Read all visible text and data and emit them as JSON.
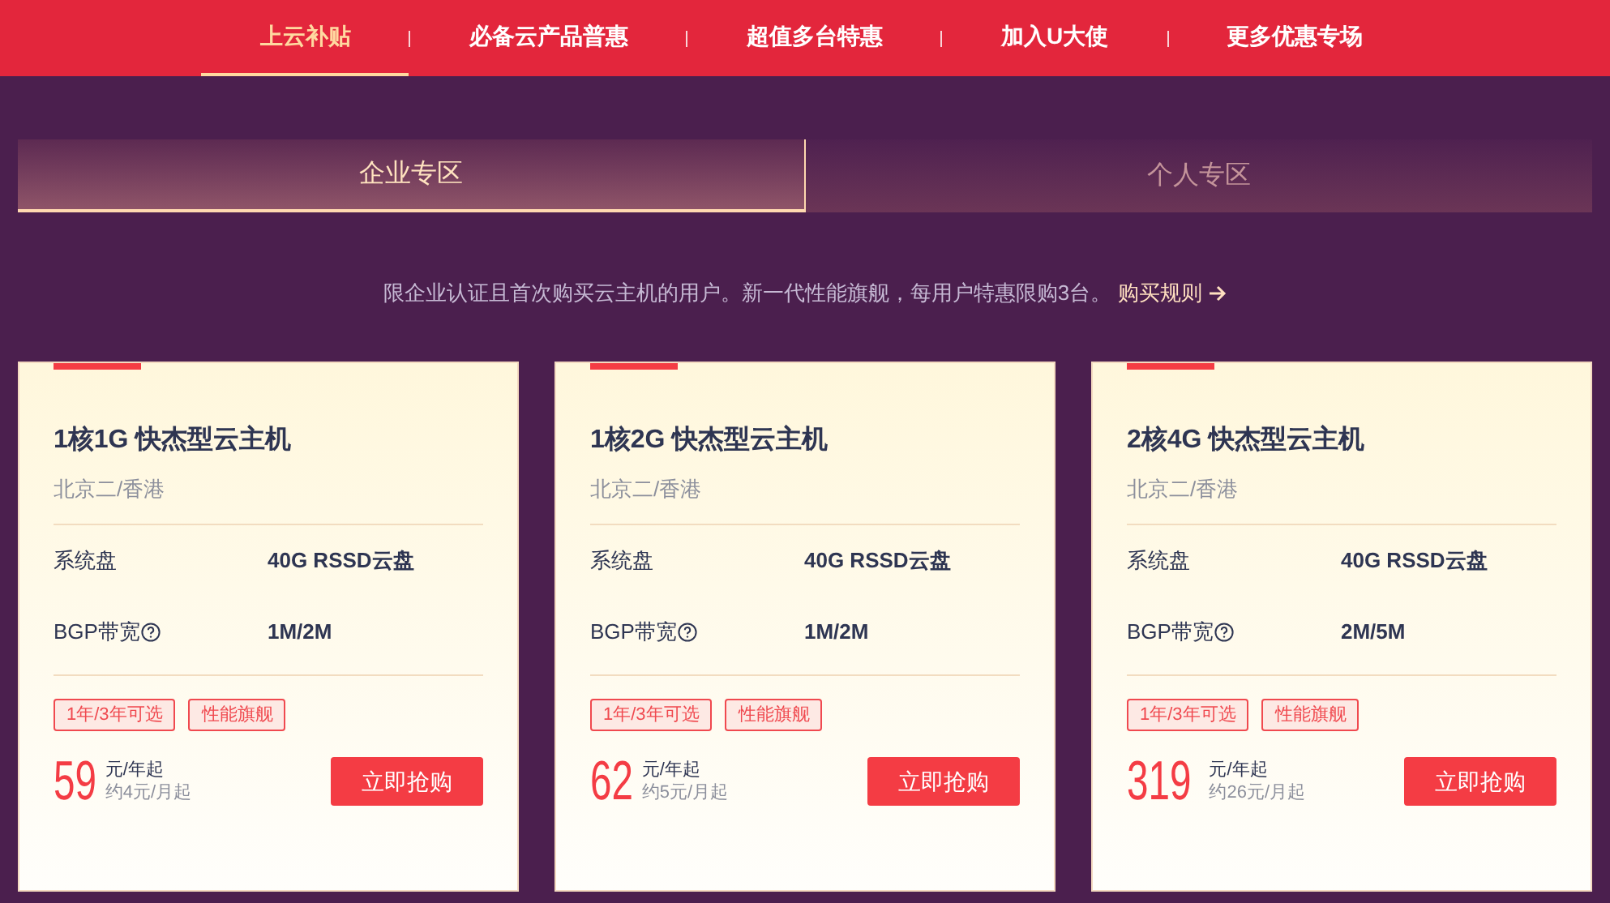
{
  "nav": [
    {
      "label": "上云补贴",
      "selected": true
    },
    {
      "label": "必备云产品普惠",
      "selected": false
    },
    {
      "label": "超值多台特惠",
      "selected": false
    },
    {
      "label": "加入U大使",
      "selected": false
    },
    {
      "label": "更多优惠专场",
      "selected": false
    }
  ],
  "tabs": [
    {
      "label": "企业专区",
      "selected": true
    },
    {
      "label": "个人专区",
      "selected": false
    }
  ],
  "notice": {
    "text": "限企业认证且首次购买云主机的用户。新一代性能旗舰，每用户特惠限购3台。",
    "link": "购买规则"
  },
  "cards": [
    {
      "title": "1核1G 快杰型云主机",
      "region": "北京二/香港",
      "specs": [
        {
          "label": "系统盘",
          "value": "40G RSSD云盘",
          "help": false
        },
        {
          "label": "BGP带宽",
          "value": "1M/2M",
          "help": true
        }
      ],
      "tags": [
        "1年/3年可选",
        "性能旗舰"
      ],
      "price": "59",
      "unit": "元/年起",
      "monthly": "约4元/月起",
      "button": "立即抢购"
    },
    {
      "title": "1核2G 快杰型云主机",
      "region": "北京二/香港",
      "specs": [
        {
          "label": "系统盘",
          "value": "40G RSSD云盘",
          "help": false
        },
        {
          "label": "BGP带宽",
          "value": "1M/2M",
          "help": true
        }
      ],
      "tags": [
        "1年/3年可选",
        "性能旗舰"
      ],
      "price": "62",
      "unit": "元/年起",
      "monthly": "约5元/月起",
      "button": "立即抢购"
    },
    {
      "title": "2核4G 快杰型云主机",
      "region": "北京二/香港",
      "specs": [
        {
          "label": "系统盘",
          "value": "40G RSSD云盘",
          "help": false
        },
        {
          "label": "BGP带宽",
          "value": "2M/5M",
          "help": true
        }
      ],
      "tags": [
        "1年/3年可选",
        "性能旗舰"
      ],
      "price": "319",
      "unit": "元/年起",
      "monthly": "约26元/月起",
      "button": "立即抢购"
    }
  ]
}
